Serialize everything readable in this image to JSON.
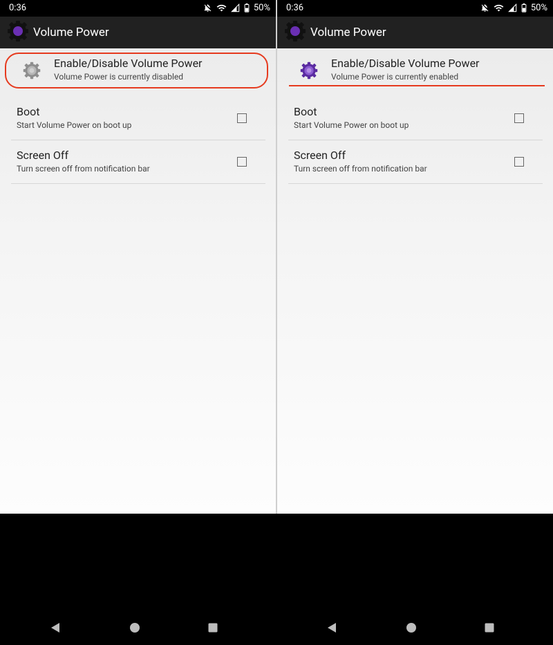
{
  "status": {
    "time": "0:36",
    "battery": "50%"
  },
  "app": {
    "title": "Volume Power"
  },
  "colors": {
    "accent": "#6a2fb3",
    "annotation": "#e63a1e",
    "appbar": "#212121"
  },
  "screens": [
    {
      "toggle": {
        "title": "Enable/Disable Volume Power",
        "summary": "Volume Power is currently disabled",
        "icon": "gear-icon-gray"
      },
      "prefs": [
        {
          "title": "Boot",
          "summary": "Start Volume Power on boot up",
          "checked": false
        },
        {
          "title": "Screen Off",
          "summary": "Turn screen off from notification bar",
          "checked": false
        }
      ]
    },
    {
      "toggle": {
        "title": "Enable/Disable Volume Power",
        "summary": "Volume Power is currently enabled",
        "icon": "gear-icon-purple"
      },
      "prefs": [
        {
          "title": "Boot",
          "summary": "Start Volume Power on boot up",
          "checked": false
        },
        {
          "title": "Screen Off",
          "summary": "Turn screen off from notification bar",
          "checked": false
        }
      ]
    }
  ],
  "nav": {
    "back_icon": "back-icon",
    "home_icon": "home-icon",
    "recents_icon": "recents-icon"
  }
}
